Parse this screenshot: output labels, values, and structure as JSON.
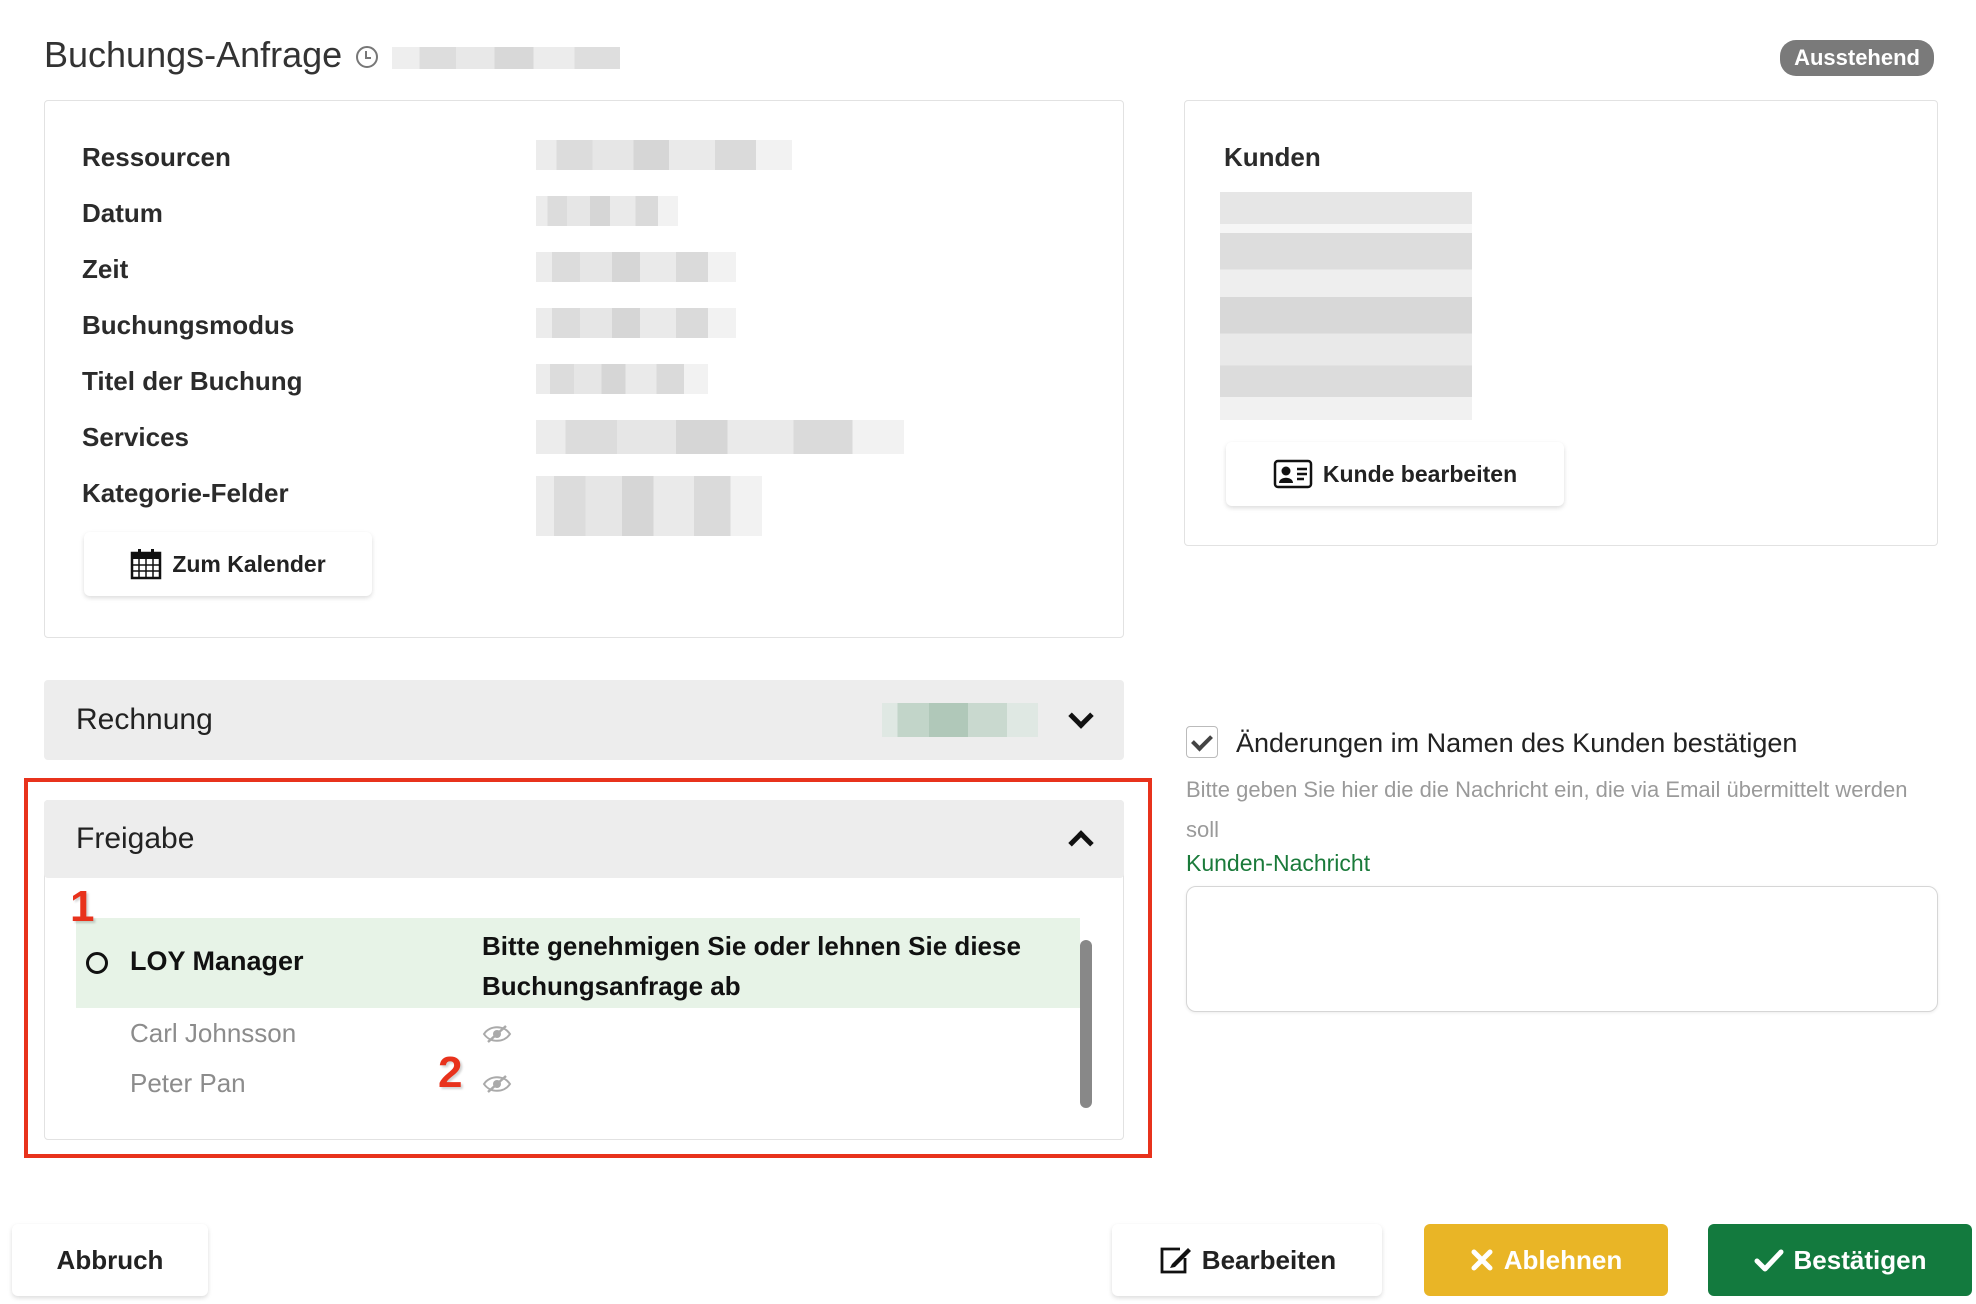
{
  "header": {
    "title": "Buchungs-Anfrage",
    "status": "Ausstehend"
  },
  "details": {
    "fields": [
      {
        "label": "Ressourcen"
      },
      {
        "label": "Datum"
      },
      {
        "label": "Zeit"
      },
      {
        "label": "Buchungsmodus"
      },
      {
        "label": "Titel der Buchung"
      },
      {
        "label": "Services"
      },
      {
        "label": "Kategorie-Felder"
      }
    ],
    "calendar_button": "Zum Kalender"
  },
  "kunden": {
    "title": "Kunden",
    "edit_button": "Kunde bearbeiten"
  },
  "rechnung": {
    "title": "Rechnung"
  },
  "freigabe": {
    "title": "Freigabe",
    "active": {
      "name": "LOY Manager",
      "message": "Bitte genehmigen Sie oder lehnen Sie diese Buchungsanfrage ab"
    },
    "approvers": [
      "Carl Johnsson",
      "Peter Pan"
    ],
    "annotation_1": "1",
    "annotation_2": "2"
  },
  "confirm": {
    "checkbox_label": "Änderungen im Namen des Kunden bestätigen",
    "hint": "Bitte geben Sie hier die die Nachricht ein, die via Email übermittelt werden soll",
    "message_label": "Kunden-Nachricht"
  },
  "actions": {
    "cancel": "Abbruch",
    "edit": "Bearbeiten",
    "reject": "Ablehnen",
    "confirm": "Bestätigen"
  },
  "colors": {
    "reject": "#e9b526",
    "confirm": "#137a3e",
    "highlight": "#e7f3e7",
    "annotation": "#e8321c"
  }
}
